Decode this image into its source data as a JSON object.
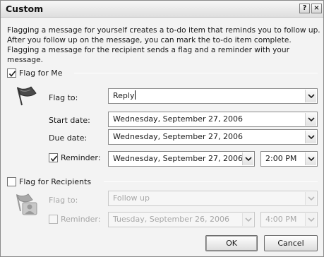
{
  "window": {
    "title": "Custom",
    "help_label": "?",
    "close_label": "×"
  },
  "intro_text": "Flagging a message for yourself creates a to-do item that reminds you to follow up. After you follow up on the message, you can mark the to-do item complete. Flagging a message for the recipient sends a flag and a reminder with your message.",
  "flag_for_me": {
    "label": "Flag for Me",
    "checked": true,
    "icon": "flag-icon",
    "flag_to_label": "Flag to:",
    "flag_to_value": "Reply",
    "start_date_label": "Start date:",
    "start_date_value": "Wednesday, September 27, 2006",
    "due_date_label": "Due date:",
    "due_date_value": "Wednesday, September 27, 2006",
    "reminder_label": "Reminder:",
    "reminder_checked": true,
    "reminder_date_value": "Wednesday, September 27, 2006",
    "reminder_time_value": "2:00 PM"
  },
  "flag_for_recipients": {
    "label": "Flag for Recipients",
    "checked": false,
    "icon": "recipient-flag-icon",
    "flag_to_label": "Flag to:",
    "flag_to_value": "Follow up",
    "reminder_label": "Reminder:",
    "reminder_checked": false,
    "reminder_date_value": "Tuesday, September 26, 2006",
    "reminder_time_value": "4:00 PM"
  },
  "buttons": {
    "ok_label": "OK",
    "cancel_label": "Cancel"
  },
  "colors": {
    "accent": "#1a1a1a",
    "disabled_text": "#a7a7a7",
    "dialog_bg": "#f3f3f3"
  }
}
